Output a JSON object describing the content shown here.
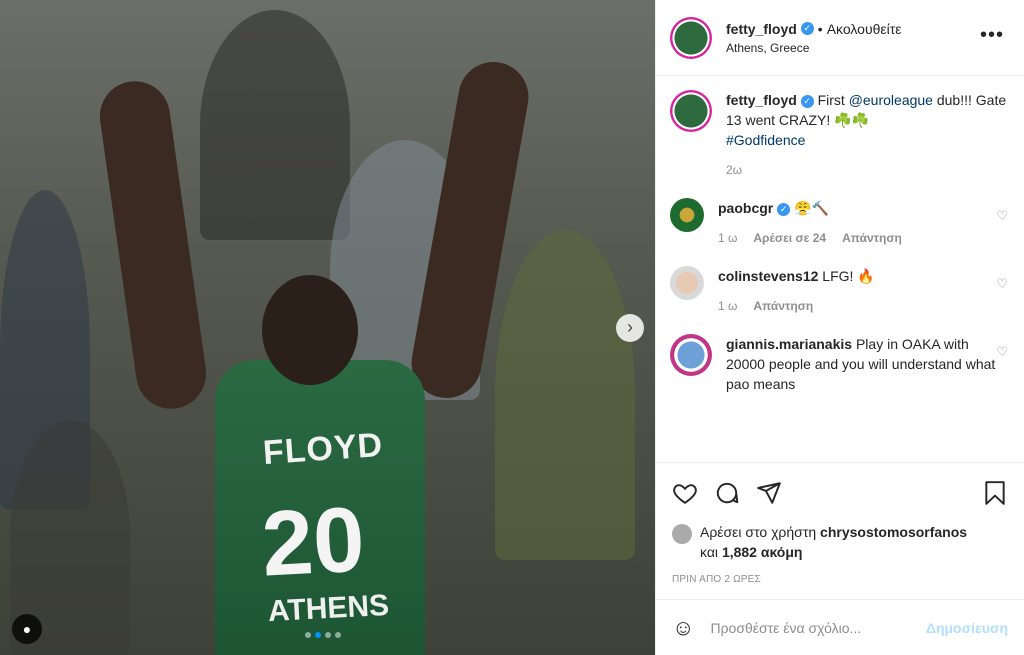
{
  "photo": {
    "jersey_name": "FLOYD",
    "jersey_number": "20",
    "jersey_city": "ATHENS",
    "next_icon": "chevron-right-icon",
    "user_tag_icon": "person-icon",
    "carousel_active_index": 1,
    "carousel_count": 4
  },
  "header": {
    "username": "fetty_floyd",
    "verified_icon": "verified-badge-icon",
    "separator": "•",
    "follow_status": "Ακολουθείτε",
    "location": "Athens, Greece",
    "more_icon": "more-options-icon"
  },
  "caption": {
    "username": "fetty_floyd",
    "text_before": "First ",
    "mention": "@euroleague",
    "text_after": " dub!!! Gate 13 went CRAZY! ☘️☘️",
    "hashtag": "#Godfidence",
    "time": "2ω"
  },
  "comments": [
    {
      "username": "paobcgr",
      "verified": true,
      "text": "😤🔨",
      "time": "1 ω",
      "likes": "Αρέσει σε 24",
      "reply": "Απάντηση"
    },
    {
      "username": "colinstevens12",
      "verified": false,
      "text": "LFG! 🔥",
      "time": "1 ω",
      "reply": "Απάντηση"
    },
    {
      "username": "giannis.marianakis",
      "verified": false,
      "text": "Play in OAKA with 20000 people and you will understand what pao means"
    }
  ],
  "likes": {
    "prefix": "Αρέσει στο χρήστη ",
    "user": "chrysostomosorfanos",
    "middle": "και ",
    "count": "1,882 ακόμη"
  },
  "timestamp": "ΠΡΙΝ ΑΠΟ 2 ΩΡΕΣ",
  "add_comment": {
    "placeholder": "Προσθέστε ένα σχόλιο...",
    "post_label": "Δημοσίευση"
  },
  "colors": {
    "link": "#00376b",
    "verified": "#3897f0",
    "muted": "#8e8e8e",
    "post_disabled": "#b2dffc"
  }
}
